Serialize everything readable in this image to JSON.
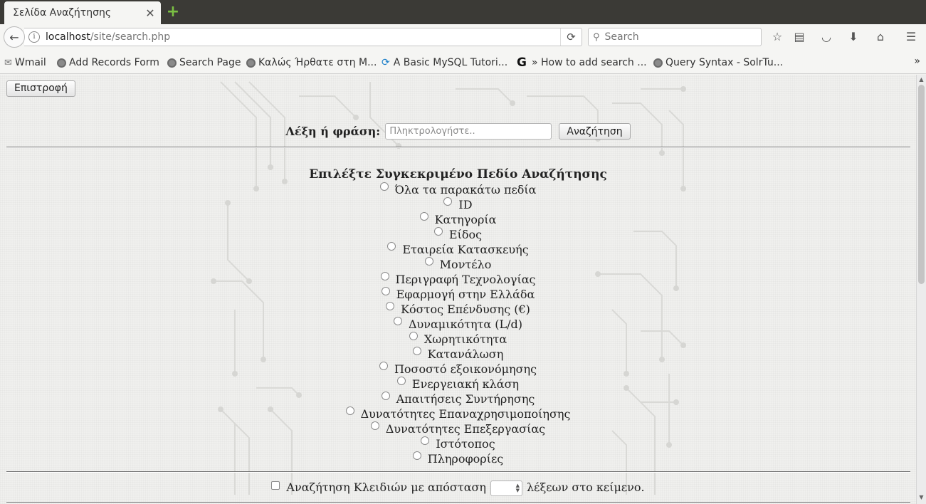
{
  "browser": {
    "tab_title": "Σελίδα Αναζήτησης",
    "url_host": "localhost",
    "url_path": "/site/search.php",
    "search_placeholder": "Search",
    "bookmarks": [
      {
        "label": "Wmail",
        "icon": "wmail-icon"
      },
      {
        "label": "Add Records Form",
        "icon": "globe-icon"
      },
      {
        "label": "Search Page",
        "icon": "globe-icon"
      },
      {
        "label": "Καλώς Ήρθατε στη Μ...",
        "icon": "globe-icon"
      },
      {
        "label": "A Basic MySQL Tutori...",
        "icon": "mysql-icon"
      },
      {
        "label": "» How to add search ...",
        "icon": "google-icon"
      },
      {
        "label": "Query Syntax - SolrTu...",
        "icon": "globe-icon"
      }
    ]
  },
  "page": {
    "back_label": "Επιστροφή",
    "search_label": "Λέξη ή φράση:",
    "search_placeholder": "Πληκτρολογήστε..",
    "search_button": "Αναζήτηση",
    "field_title": "Επιλέξτε Συγκεκριμένο Πεδίο Αναζήτησης",
    "fields": [
      "Όλα τα παρακάτω πεδία",
      "ID",
      "Κατηγορία",
      "Είδος",
      "Εταιρεία Κατασκευής",
      "Μοντέλο",
      "Περιγραφή Τεχνολογίας",
      "Εφαρμογή στην Ελλάδα",
      "Κόστος Επένδυσης (€)",
      "Δυναμικότητα (L/d)",
      "Χωρητικότητα",
      "Κατανάλωση",
      "Ποσοστό εξοικονόμησης",
      "Ενεργειακή κλάση",
      "Απαιτήσεις Συντήρησης",
      "Δυνατότητες Επαναχρησιμοποίησης",
      "Δυνατότητες Επεξεργασίας",
      "Ιστότοπος",
      "Πληροφορίες"
    ],
    "kwic_label_before": "Αναζήτηση Κλειδιών με απόσταση",
    "kwic_label_after": "λέξεων στο κείμενο."
  }
}
